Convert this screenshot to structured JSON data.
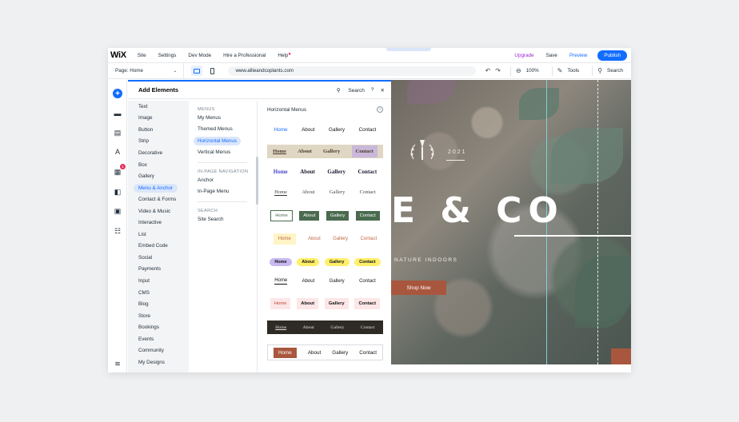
{
  "topbar": {
    "logo": "WiX",
    "nav": [
      "Site",
      "Settings",
      "Dev Mode",
      "Hire a Professional",
      "Help"
    ],
    "upgrade": "Upgrade",
    "save": "Save",
    "preview": "Preview",
    "publish": "Publish"
  },
  "toolbar": {
    "page": "Page: Home",
    "url": "www.allieandcoplants.com",
    "zoom": "100%",
    "tools": "Tools",
    "search": "Search"
  },
  "panel": {
    "title": "Add Elements",
    "search": "Search",
    "help": "?",
    "close": "✕",
    "categories": [
      "Text",
      "Image",
      "Button",
      "Strip",
      "Decorative",
      "Box",
      "Gallery",
      "Menu & Anchor",
      "Contact & Forms",
      "Video & Music",
      "Interactive",
      "List",
      "Embed Code",
      "Social",
      "Payments",
      "Input",
      "CMS",
      "Blog",
      "Store",
      "Bookings",
      "Events",
      "Community",
      "My Designs"
    ],
    "active_category": "Menu & Anchor",
    "menus_section": "MENUS",
    "menus": [
      "My Menus",
      "Themed Menus",
      "Horizontal Menus",
      "Vertical Menus"
    ],
    "active_menu": "Horizontal Menus",
    "inpage_section": "IN-PAGE NAVIGATION",
    "inpage": [
      "Anchor",
      "In-Page Menu"
    ],
    "search_section": "SEARCH",
    "search_items": [
      "Site Search"
    ],
    "preview_title": "Horizontal Menus",
    "info": "i",
    "menu_items": [
      "Home",
      "About",
      "Gallery",
      "Contact"
    ]
  },
  "canvas": {
    "year": "2021",
    "hero": "E & CO",
    "tagline": "NATURE INDOORS",
    "shop": "Shop Now"
  },
  "colors": {
    "accent": "#116dff",
    "upgrade": "#9a27d5",
    "brand_terracotta": "#a8573e"
  }
}
